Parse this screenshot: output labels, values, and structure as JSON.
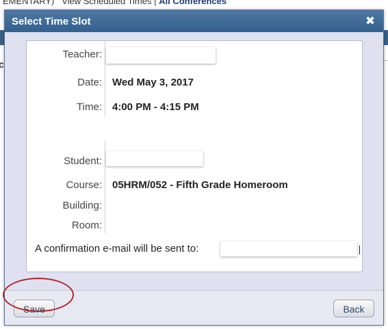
{
  "background": {
    "top_text_plain": "EMENTARY)",
    "top_text_link": "View Scheduled Times",
    "top_text_sep": "|",
    "top_text_bold": "All Conferences",
    "left_fragment": "c"
  },
  "dialog": {
    "title": "Select Time Slot",
    "close_icon": "close-icon"
  },
  "details": {
    "teacher_label": "Teacher:",
    "teacher_value": "",
    "date_label": "Date:",
    "date_value": "Wed May 3, 2017",
    "time_label": "Time:",
    "time_value": "4:00 PM - 4:15 PM",
    "student_label": "Student:",
    "student_value": "",
    "course_label": "Course:",
    "course_value": "05HRM/052 - Fifth Grade Homeroom",
    "building_label": "Building:",
    "building_value": "",
    "room_label": "Room:",
    "room_value": ""
  },
  "confirmation": {
    "text": "A confirmation e-mail will be sent to:",
    "email": ""
  },
  "buttons": {
    "save_label": "Save",
    "back_label": "Back"
  },
  "colors": {
    "titlebar": "#3b6793",
    "highlight_ring": "#b3262b"
  }
}
